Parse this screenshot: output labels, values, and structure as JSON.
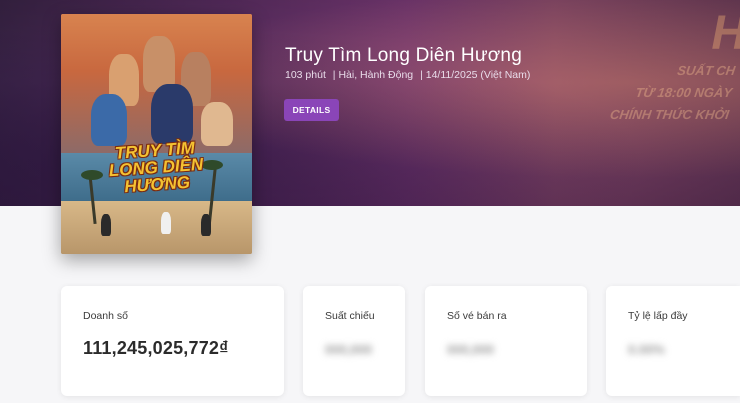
{
  "movie": {
    "title": "Truy Tìm Long Diên Hương",
    "duration": "103 phút",
    "genres": "| Hài, Hành Động",
    "release": "| 14/11/2025 (Việt Nam)",
    "details_label": "DETAILS",
    "poster_title_line1": "TRUY TÌM",
    "poster_title_line2": "LONG DIÊN",
    "poster_title_line3": "HƯƠNG"
  },
  "banner_text": {
    "big": "H",
    "line1": "SUẤT CH",
    "line2": "TỪ 18:00 NGÀY",
    "line3": "CHÍNH THỨC KHỞI"
  },
  "stats": [
    {
      "label": "Doanh số",
      "value": "111,245,025,772₫",
      "hidden": false
    },
    {
      "label": "Suất chiếu",
      "value": "000,000",
      "hidden": true
    },
    {
      "label": "Số vé bán ra",
      "value": "000,000",
      "hidden": true
    },
    {
      "label": "Tỷ lệ lấp đầy",
      "value": "0.00%",
      "hidden": true
    }
  ],
  "colors": {
    "accent": "#8a45b8",
    "hero_start": "#3a2447",
    "hero_end": "#8a4a6e"
  }
}
